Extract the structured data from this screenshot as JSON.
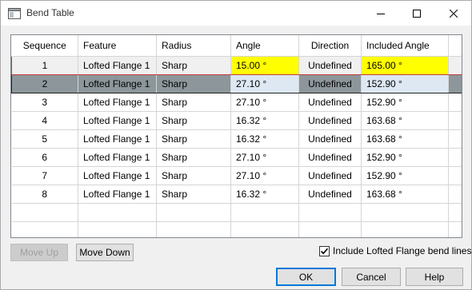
{
  "window": {
    "title": "Bend Table"
  },
  "table": {
    "columns": [
      "Sequence",
      "Feature",
      "Radius",
      "Angle",
      "Direction",
      "Included Angle"
    ],
    "rows": [
      [
        "1",
        "Lofted Flange 1",
        "Sharp",
        "15.00 °",
        "Undefined",
        "165.00 °"
      ],
      [
        "2",
        "Lofted Flange 1",
        "Sharp",
        "27.10 °",
        "Undefined",
        "152.90 °"
      ],
      [
        "3",
        "Lofted Flange 1",
        "Sharp",
        "27.10 °",
        "Undefined",
        "152.90 °"
      ],
      [
        "4",
        "Lofted Flange 1",
        "Sharp",
        "16.32 °",
        "Undefined",
        "163.68 °"
      ],
      [
        "5",
        "Lofted Flange 1",
        "Sharp",
        "16.32 °",
        "Undefined",
        "163.68 °"
      ],
      [
        "6",
        "Lofted Flange 1",
        "Sharp",
        "27.10 °",
        "Undefined",
        "152.90 °"
      ],
      [
        "7",
        "Lofted Flange 1",
        "Sharp",
        "27.10 °",
        "Undefined",
        "152.90 °"
      ],
      [
        "8",
        "Lofted Flange 1",
        "Sharp",
        "16.32 °",
        "Undefined",
        "163.68 °"
      ]
    ]
  },
  "buttons": {
    "move_up": "Move Up",
    "move_down": "Move Down",
    "ok": "OK",
    "cancel": "Cancel",
    "help": "Help"
  },
  "checkbox": {
    "label": "Include Lofted Flange bend lines",
    "checked": true
  },
  "colors": {
    "highlight": "#ffff00",
    "selected_row": "#8c969b",
    "accent": "#0078d7"
  }
}
